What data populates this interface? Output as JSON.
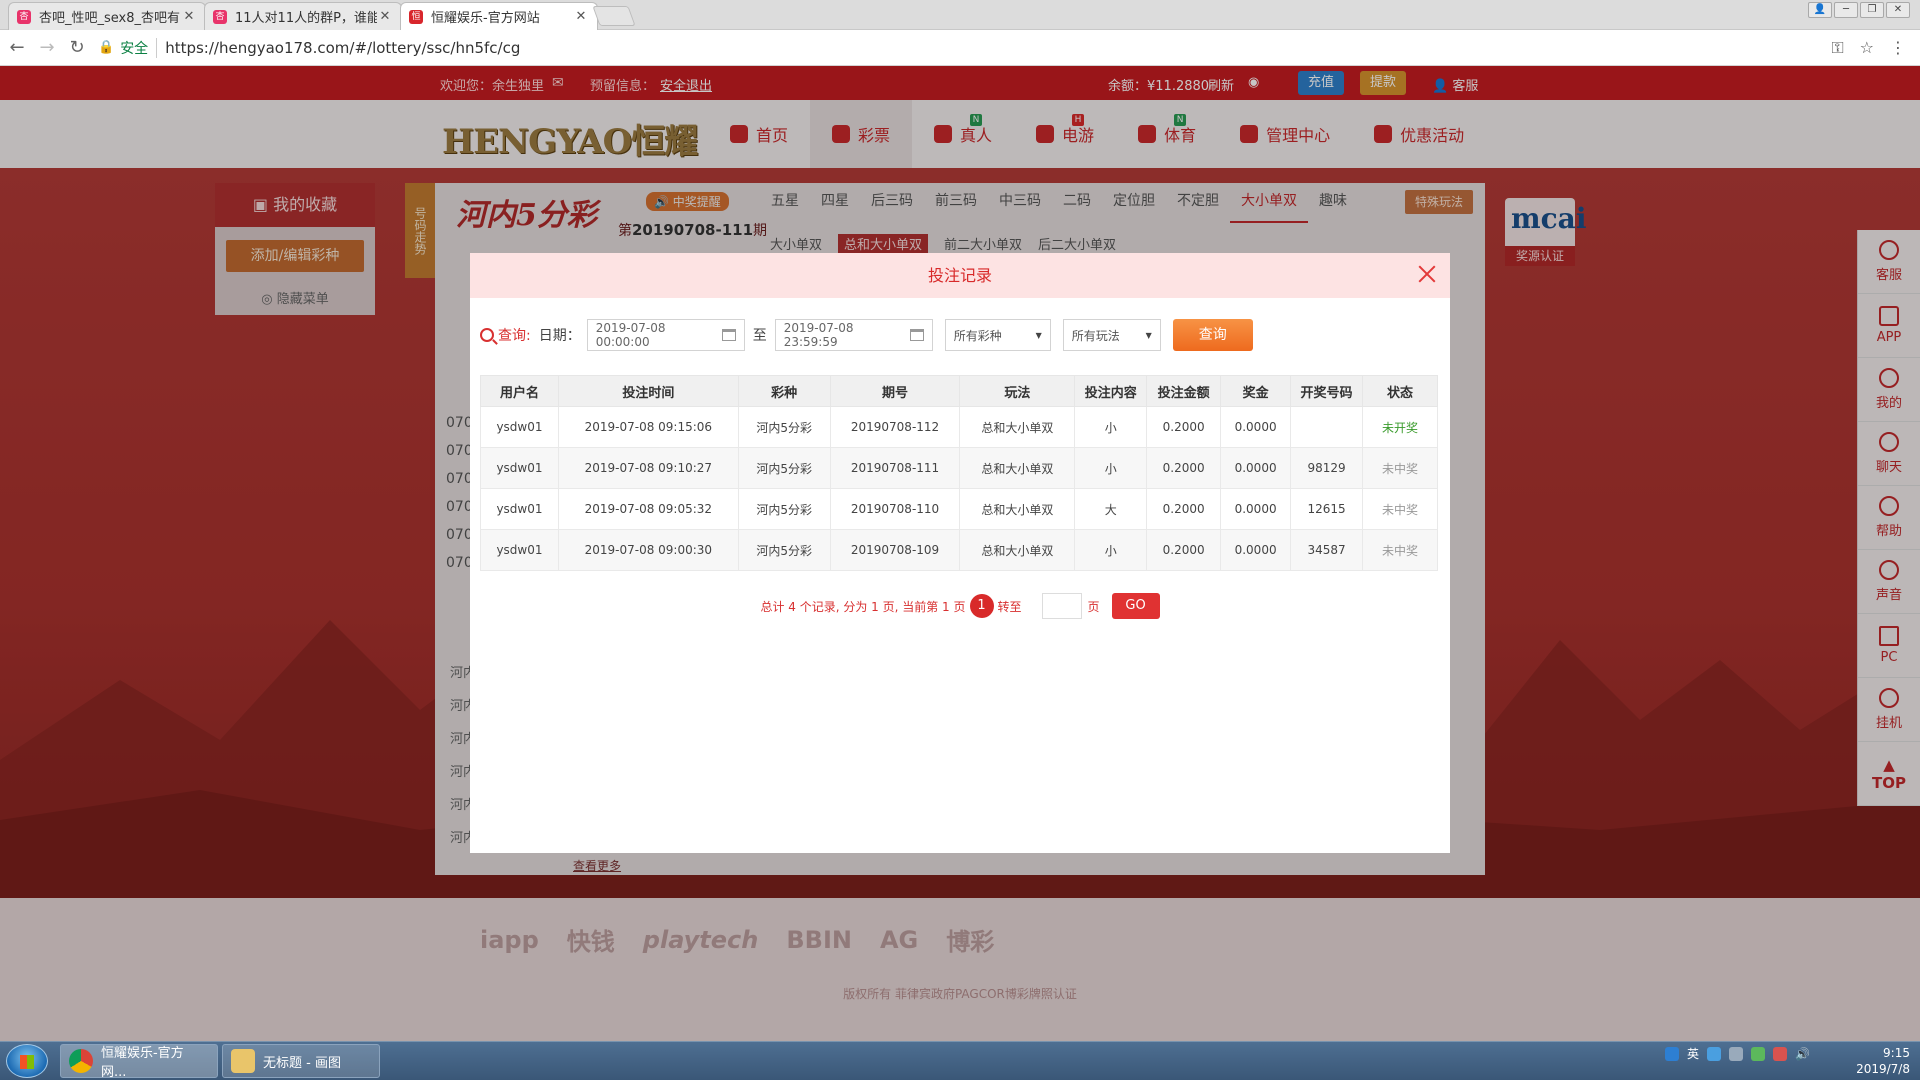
{
  "browser": {
    "tabs": [
      {
        "title": "杏吧_性吧_sex8_杏吧有"
      },
      {
        "title": "11人对11人的群P，谁能"
      },
      {
        "title": "恒耀娱乐-官方网站"
      }
    ],
    "secure_label": "安全",
    "url": "https://hengyao178.com/#/lottery/ssc/hn5fc/cg"
  },
  "site_top": {
    "welcome": "欢迎您：余生独里",
    "preview_info": "预留信息：",
    "logout": "安全退出",
    "balance": "余额：¥11.2880",
    "refresh": "刷新",
    "deposit": "充值",
    "withdraw": "提款",
    "service": "客服"
  },
  "header": {
    "logo": "HENGYAO恒耀",
    "nav": [
      {
        "label": "首页",
        "badge": ""
      },
      {
        "label": "彩票",
        "badge": ""
      },
      {
        "label": "真人",
        "badge": "N"
      },
      {
        "label": "电游",
        "badge": "H"
      },
      {
        "label": "体育",
        "badge": "N"
      },
      {
        "label": "管理中心",
        "badge": ""
      },
      {
        "label": "优惠活动",
        "badge": ""
      }
    ]
  },
  "left_panel": {
    "title": "我的收藏",
    "add_button": "添加/编辑彩种",
    "hide_menu": "隐藏菜单",
    "trend_tag": "号码走势"
  },
  "game": {
    "title": "河内5分彩",
    "period_prefix": "第",
    "period": "20190708-111",
    "period_suffix": "期",
    "win_notice": "中奖提醒",
    "tabs": [
      "五星",
      "四星",
      "后三码",
      "前三码",
      "中三码",
      "二码",
      "定位胆",
      "不定胆",
      "大小单双",
      "趣味"
    ],
    "special": "特殊玩法",
    "subtabs": [
      "大小单双",
      "总和大小单双",
      "前二大小单双",
      "后二大小单双"
    ],
    "row_prefixes": [
      "070",
      "070",
      "070",
      "070",
      "070",
      "070"
    ],
    "list_prefixes": [
      "河内",
      "河内",
      "河内",
      "河内",
      "河内",
      "河内"
    ],
    "see_more": "查看更多",
    "mcai_logo": "mcai",
    "mcai_label": "奖源认证"
  },
  "right_bar": {
    "items": [
      "客服",
      "APP",
      "我的",
      "聊天",
      "帮助",
      "声音",
      "PC",
      "挂机",
      "TOP"
    ]
  },
  "footer": {
    "logos": [
      "iapp",
      "快钱",
      "playtech",
      "BBIN",
      "AG",
      "博彩"
    ],
    "copyright": "版权所有 菲律宾政府PAGCOR博彩牌照认证"
  },
  "modal": {
    "title": "投注记录",
    "query_label": "查询:",
    "date_label": "日期：",
    "date_from": "2019-07-08 00:00:00",
    "to_label": "至",
    "date_to": "2019-07-08 23:59:59",
    "lottery_select": "所有彩种",
    "play_select": "所有玩法",
    "query_button": "查询",
    "columns": [
      "用户名",
      "投注时间",
      "彩种",
      "期号",
      "玩法",
      "投注内容",
      "投注金额",
      "奖金",
      "开奖号码",
      "状态"
    ],
    "rows": [
      [
        "ysdw01",
        "2019-07-08 09:15:06",
        "河内5分彩",
        "20190708-112",
        "总和大小单双",
        "小",
        "0.2000",
        "0.0000",
        "",
        "未开奖"
      ],
      [
        "ysdw01",
        "2019-07-08 09:10:27",
        "河内5分彩",
        "20190708-111",
        "总和大小单双",
        "小",
        "0.2000",
        "0.0000",
        "98129",
        "未中奖"
      ],
      [
        "ysdw01",
        "2019-07-08 09:05:32",
        "河内5分彩",
        "20190708-110",
        "总和大小单双",
        "大",
        "0.2000",
        "0.0000",
        "12615",
        "未中奖"
      ],
      [
        "ysdw01",
        "2019-07-08 09:00:30",
        "河内5分彩",
        "20190708-109",
        "总和大小单双",
        "小",
        "0.2000",
        "0.0000",
        "34587",
        "未中奖"
      ]
    ],
    "pager": {
      "summary": "总计 4 个记录, 分为 1 页, 当前第 1 页",
      "current": "1",
      "goto_label": "转至",
      "page_unit": "页",
      "go": "GO"
    }
  },
  "taskbar": {
    "tasks": [
      "恒耀娱乐-官方网...",
      "无标题 - 画图"
    ],
    "ime": "英",
    "time": "9:15",
    "date": "2019/7/8"
  }
}
